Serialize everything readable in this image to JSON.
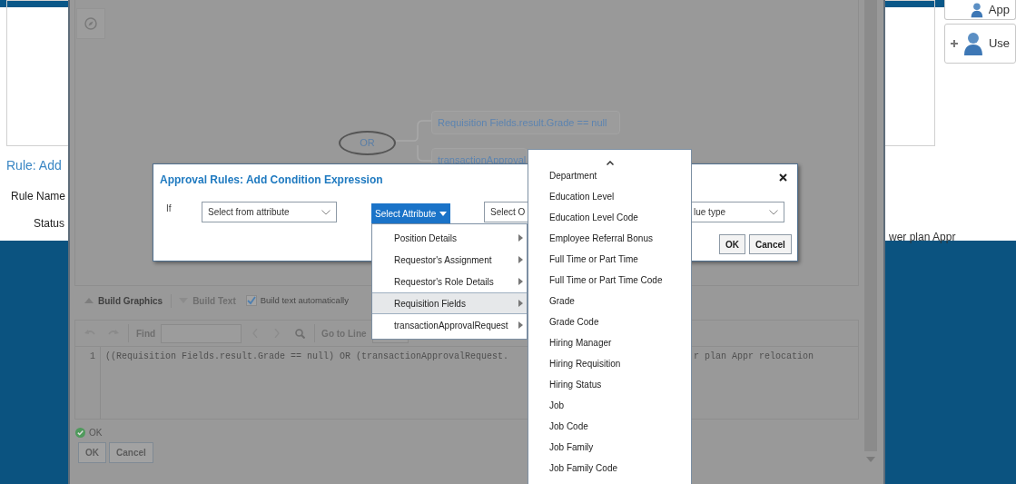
{
  "background_page": {
    "heading": "Rule: Add",
    "labels": [
      "Rule Name",
      "Status"
    ],
    "side_items": [
      "App",
      "Use"
    ],
    "trailing_text": "wer plan Appr"
  },
  "rule_editor": {
    "graph": {
      "root": "OR",
      "conditions": [
        "Requisition Fields.result.Grade == null",
        "transactionApproval"
      ]
    },
    "build_buttons": [
      {
        "label": "Build Graphics",
        "disabled": false
      },
      {
        "label": "Build Text",
        "disabled": true
      }
    ],
    "auto_build": {
      "label": "Build text automatically",
      "checked": true
    },
    "find_label": "Find",
    "goto_label": "Go to Line",
    "code": {
      "line_number": "1",
      "visible_parts": [
        "((Requisition Fields.result.Grade == null) OR (transactionApprovalRequest.",
        "r plan Appr relocation"
      ]
    },
    "validation": "OK",
    "buttons": [
      "OK",
      "Cancel"
    ]
  },
  "dialog": {
    "title": "Approval Rules: Add Condition Expression",
    "if_label": "If",
    "from_select": "Select from attribute",
    "attribute_button": "Select Attribute",
    "operator_select": "Select O",
    "value_select": "lue type",
    "buttons": [
      "OK",
      "Cancel"
    ]
  },
  "attribute_menu": [
    {
      "label": "Position Details",
      "selected": false
    },
    {
      "label": "Requestor's Assignment",
      "selected": false
    },
    {
      "label": "Requestor's Role Details",
      "selected": false
    },
    {
      "label": "Requisition Fields",
      "selected": true
    },
    {
      "label": "transactionApprovalRequest",
      "selected": false
    }
  ],
  "submenu": [
    "Department",
    "Education Level",
    "Education Level Code",
    "Employee Referral Bonus",
    "Full Time or Part Time",
    "Full Time or Part Time Code",
    "Grade",
    "Grade Code",
    "Hiring Manager",
    "Hiring Requisition",
    "Hiring Status",
    "Job",
    "Job Code",
    "Job Family",
    "Job Family Code"
  ]
}
